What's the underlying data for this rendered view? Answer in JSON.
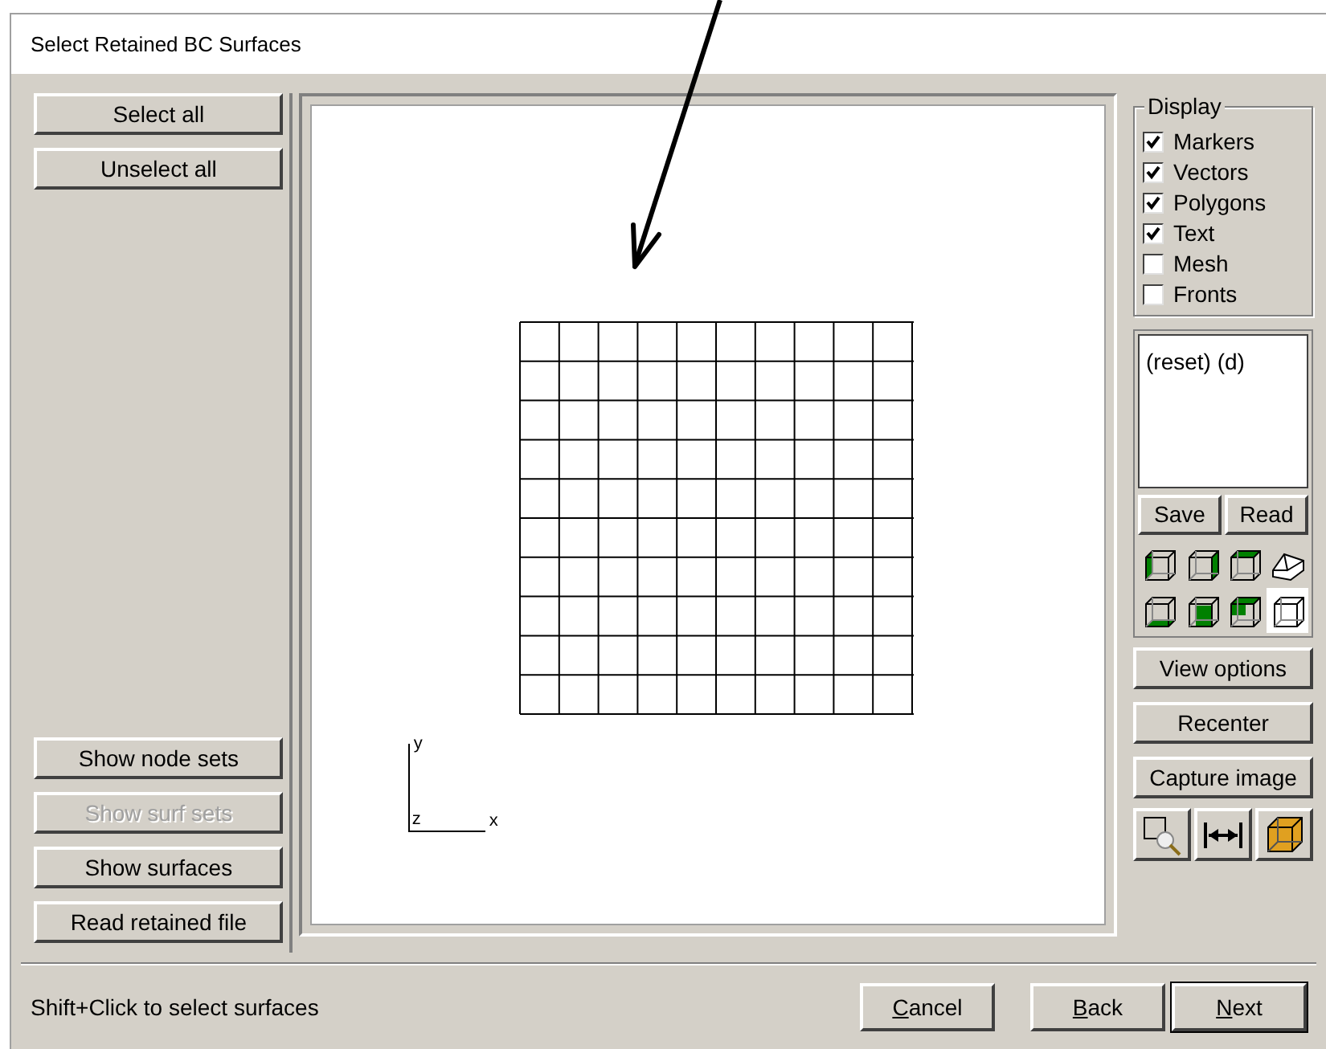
{
  "window": {
    "title": "Select Retained BC Surfaces"
  },
  "left_buttons_top": [
    {
      "label": "Select all",
      "disabled": false
    },
    {
      "label": "Unselect all",
      "disabled": false
    }
  ],
  "left_buttons_bottom": [
    {
      "label": "Show node sets",
      "disabled": false
    },
    {
      "label": "Show surf sets",
      "disabled": true
    },
    {
      "label": "Show surfaces",
      "disabled": false
    },
    {
      "label": "Read retained file",
      "disabled": false
    }
  ],
  "viewport": {
    "axes": {
      "y": "y",
      "z": "z",
      "x": "x"
    }
  },
  "display": {
    "title": "Display",
    "options": [
      {
        "label": "Markers",
        "checked": true
      },
      {
        "label": "Vectors",
        "checked": true
      },
      {
        "label": "Polygons",
        "checked": true
      },
      {
        "label": "Text",
        "checked": true
      },
      {
        "label": "Mesh",
        "checked": false
      },
      {
        "label": "Fronts",
        "checked": false
      }
    ]
  },
  "views_text": "(reset) (d)",
  "view_file_buttons": [
    "Save",
    "Read"
  ],
  "view_presets": [
    {
      "selected": false
    },
    {
      "selected": false
    },
    {
      "selected": false
    },
    {
      "selected": false
    },
    {
      "selected": false
    },
    {
      "selected": false
    },
    {
      "selected": false
    },
    {
      "selected": true
    }
  ],
  "right_buttons": [
    "View options",
    "Recenter",
    "Capture image"
  ],
  "status": "Shift+Click to select surfaces",
  "footer_buttons": [
    {
      "label": "Cancel",
      "default": false
    },
    {
      "label": "Back",
      "default": false
    },
    {
      "label": "Next",
      "default": true
    }
  ]
}
